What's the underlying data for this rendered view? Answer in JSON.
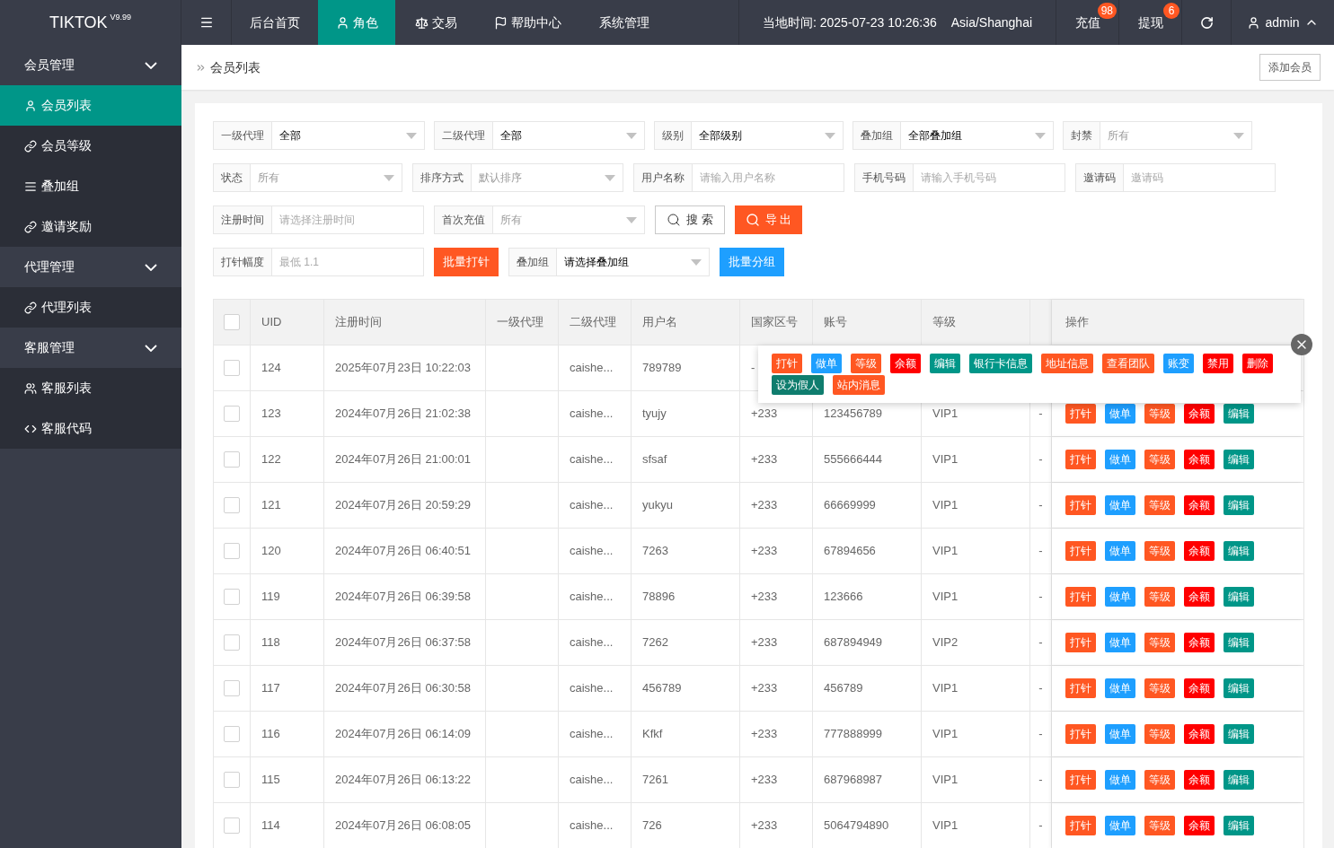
{
  "brand": {
    "name": "TIKTOK",
    "version": "V9.99"
  },
  "top_menu": [
    {
      "label": "后台首页",
      "selected": false
    },
    {
      "label": "角色",
      "selected": true
    },
    {
      "label": "交易",
      "selected": false
    },
    {
      "label": "帮助中心",
      "selected": false
    },
    {
      "label": "系统管理",
      "selected": false
    }
  ],
  "header": {
    "time": "当地时间: 2025-07-23 10:26:36",
    "timezone": "Asia/Shanghai",
    "recharge": {
      "label": "充值",
      "badge": "98"
    },
    "withdraw": {
      "label": "提现",
      "badge": "6"
    },
    "user": "admin"
  },
  "sidebar": [
    {
      "label": "会员管理",
      "expanded": true,
      "children": [
        {
          "label": "会员列表",
          "selected": true
        },
        {
          "label": "会员等级",
          "selected": false
        },
        {
          "label": "叠加组",
          "selected": false
        },
        {
          "label": "邀请奖励",
          "selected": false
        }
      ]
    },
    {
      "label": "代理管理",
      "expanded": true,
      "children": [
        {
          "label": "代理列表",
          "selected": false
        }
      ]
    },
    {
      "label": "客服管理",
      "expanded": true,
      "children": [
        {
          "label": "客服列表",
          "selected": false
        },
        {
          "label": "客服代码",
          "selected": false
        }
      ]
    }
  ],
  "breadcrumb": "会员列表",
  "add_button": "添加会员",
  "filters": [
    [
      {
        "kind": "select",
        "label": "一级代理",
        "value": "全部"
      },
      {
        "kind": "select",
        "label": "二级代理",
        "value": "全部"
      },
      {
        "kind": "select",
        "label": "级别",
        "value": "全部级别"
      },
      {
        "kind": "select",
        "label": "叠加组",
        "value": "全部叠加组"
      },
      {
        "kind": "select",
        "label": "封禁",
        "placeholder": "所有"
      }
    ],
    [
      {
        "kind": "select",
        "label": "状态",
        "placeholder": "所有"
      },
      {
        "kind": "select",
        "label": "排序方式",
        "placeholder": "默认排序"
      },
      {
        "kind": "input",
        "label": "用户名称",
        "placeholder": "请输入用户名称"
      },
      {
        "kind": "input",
        "label": "手机号码",
        "placeholder": "请输入手机号码"
      },
      {
        "kind": "input",
        "label": "邀请码",
        "placeholder": "邀请码"
      }
    ],
    [
      {
        "kind": "input",
        "label": "注册时间",
        "placeholder": "请选择注册时间"
      },
      {
        "kind": "select",
        "label": "首次充值",
        "placeholder": "所有"
      },
      {
        "kind": "search",
        "label": "搜 索"
      },
      {
        "kind": "export",
        "label": "导 出"
      }
    ],
    [
      {
        "kind": "input",
        "label": "打针幅度",
        "placeholder": "最低 1.1"
      },
      {
        "kind": "button",
        "label": "批量打针",
        "color": "#ff5722"
      },
      {
        "kind": "select",
        "label": "叠加组",
        "value": "请选择叠加组"
      },
      {
        "kind": "button",
        "label": "批量分组",
        "color": "#1e9fff"
      }
    ]
  ],
  "table": {
    "all_checked": false,
    "columns": [
      "UID",
      "注册时间",
      "一级代理",
      "二级代理",
      "用户名",
      "国家区号",
      "账号",
      "等级",
      "操作"
    ],
    "rows": [
      {
        "checked": false,
        "uid": "124",
        "time": "2025年07月23日 10:22:03",
        "agent2": "caishe...",
        "username": "789789",
        "country": "-"
      },
      {
        "checked": false,
        "uid": "123",
        "time": "2024年07月26日 21:02:38",
        "agent2": "caishe...",
        "username": "tyujy",
        "country": "+233",
        "account": "123456789",
        "level": "VIP1",
        "column_9": "-",
        "actions": [
          {
            "label": "打针",
            "color": "#ff5722"
          },
          {
            "label": "做单",
            "color": "#1e9fff"
          },
          {
            "label": "等级",
            "color": "#ff5722"
          },
          {
            "label": "余额",
            "color": "#ff0000"
          },
          {
            "label": "编辑",
            "color": "#009688"
          }
        ]
      },
      {
        "checked": false,
        "uid": "122",
        "time": "2024年07月26日 21:00:01",
        "agent2": "caishe...",
        "username": "sfsaf",
        "country": "+233",
        "account": "555666444",
        "level": "VIP1",
        "column_9": "-",
        "actions": [
          {
            "label": "打针",
            "color": "#ff5722"
          },
          {
            "label": "做单",
            "color": "#1e9fff"
          },
          {
            "label": "等级",
            "color": "#ff5722"
          },
          {
            "label": "余额",
            "color": "#ff0000"
          },
          {
            "label": "编辑",
            "color": "#009688"
          }
        ]
      },
      {
        "checked": false,
        "uid": "121",
        "time": "2024年07月26日 20:59:29",
        "agent2": "caishe...",
        "username": "yukyu",
        "country": "+233",
        "account": "66669999",
        "level": "VIP1",
        "column_9": "-",
        "actions": [
          {
            "label": "打针",
            "color": "#ff5722"
          },
          {
            "label": "做单",
            "color": "#1e9fff"
          },
          {
            "label": "等级",
            "color": "#ff5722"
          },
          {
            "label": "余额",
            "color": "#ff0000"
          },
          {
            "label": "编辑",
            "color": "#009688"
          }
        ]
      },
      {
        "checked": false,
        "uid": "120",
        "time": "2024年07月26日 06:40:51",
        "agent2": "caishe...",
        "username": "7263",
        "country": "+233",
        "account": "67894656",
        "level": "VIP1",
        "column_9": "-",
        "actions": [
          {
            "label": "打针",
            "color": "#ff5722"
          },
          {
            "label": "做单",
            "color": "#1e9fff"
          },
          {
            "label": "等级",
            "color": "#ff5722"
          },
          {
            "label": "余额",
            "color": "#ff0000"
          },
          {
            "label": "编辑",
            "color": "#009688"
          }
        ]
      },
      {
        "checked": false,
        "uid": "119",
        "time": "2024年07月26日 06:39:58",
        "agent2": "caishe...",
        "username": "78896",
        "country": "+233",
        "account": "123666",
        "level": "VIP1",
        "column_9": "-",
        "actions": [
          {
            "label": "打针",
            "color": "#ff5722"
          },
          {
            "label": "做单",
            "color": "#1e9fff"
          },
          {
            "label": "等级",
            "color": "#ff5722"
          },
          {
            "label": "余额",
            "color": "#ff0000"
          },
          {
            "label": "编辑",
            "color": "#009688"
          }
        ]
      },
      {
        "checked": false,
        "uid": "118",
        "time": "2024年07月26日 06:37:58",
        "agent2": "caishe...",
        "username": "7262",
        "country": "+233",
        "account": "687894949",
        "level": "VIP2",
        "column_9": "-",
        "actions": [
          {
            "label": "打针",
            "color": "#ff5722"
          },
          {
            "label": "做单",
            "color": "#1e9fff"
          },
          {
            "label": "等级",
            "color": "#ff5722"
          },
          {
            "label": "余额",
            "color": "#ff0000"
          },
          {
            "label": "编辑",
            "color": "#009688"
          }
        ]
      },
      {
        "checked": false,
        "uid": "117",
        "time": "2024年07月26日 06:30:58",
        "agent2": "caishe...",
        "username": "456789",
        "country": "+233",
        "account": "456789",
        "level": "VIP1",
        "column_9": "-",
        "actions": [
          {
            "label": "打针",
            "color": "#ff5722"
          },
          {
            "label": "做单",
            "color": "#1e9fff"
          },
          {
            "label": "等级",
            "color": "#ff5722"
          },
          {
            "label": "余额",
            "color": "#ff0000"
          },
          {
            "label": "编辑",
            "color": "#009688"
          }
        ]
      },
      {
        "checked": false,
        "uid": "116",
        "time": "2024年07月26日 06:14:09",
        "agent2": "caishe...",
        "username": "Kfkf",
        "country": "+233",
        "account": "777888999",
        "level": "VIP1",
        "column_9": "-",
        "actions": [
          {
            "label": "打针",
            "color": "#ff5722"
          },
          {
            "label": "做单",
            "color": "#1e9fff"
          },
          {
            "label": "等级",
            "color": "#ff5722"
          },
          {
            "label": "余额",
            "color": "#ff0000"
          },
          {
            "label": "编辑",
            "color": "#009688"
          }
        ]
      },
      {
        "checked": false,
        "uid": "115",
        "time": "2024年07月26日 06:13:22",
        "agent2": "caishe...",
        "username": "7261",
        "country": "+233",
        "account": "687968987",
        "level": "VIP1",
        "column_9": "-",
        "actions": [
          {
            "label": "打针",
            "color": "#ff5722"
          },
          {
            "label": "做单",
            "color": "#1e9fff"
          },
          {
            "label": "等级",
            "color": "#ff5722"
          },
          {
            "label": "余额",
            "color": "#ff0000"
          },
          {
            "label": "编辑",
            "color": "#009688"
          }
        ]
      },
      {
        "checked": false,
        "uid": "114",
        "time": "2024年07月26日 06:08:05",
        "agent2": "caishe...",
        "username": "726",
        "country": "+233",
        "account": "5064794890",
        "level": "VIP1",
        "column_9": "-",
        "actions": [
          {
            "label": "打针",
            "color": "#ff5722"
          },
          {
            "label": "做单",
            "color": "#1e9fff"
          },
          {
            "label": "等级",
            "color": "#ff5722"
          },
          {
            "label": "余额",
            "color": "#ff0000"
          },
          {
            "label": "编辑",
            "color": "#009688"
          }
        ]
      }
    ]
  },
  "action_menu": {
    "open": true,
    "buttons": [
      {
        "label": "打针",
        "color": "#ff5722"
      },
      {
        "label": "做单",
        "color": "#1e9fff"
      },
      {
        "label": "等级",
        "color": "#ff5722"
      },
      {
        "label": "余额",
        "color": "#ff0000"
      },
      {
        "label": "编辑",
        "color": "#009688"
      },
      {
        "label": "银行卡信息",
        "color": "#009688"
      },
      {
        "label": "地址信息",
        "color": "#ff5722"
      },
      {
        "label": "查看团队",
        "color": "#ff5722"
      },
      {
        "label": "账变",
        "color": "#1e9fff"
      },
      {
        "label": "禁用",
        "color": "#ff0000"
      },
      {
        "label": "删除",
        "color": "#ff0000"
      },
      {
        "label": "设为假人",
        "color": "#0f7d6e"
      },
      {
        "label": "站内消息",
        "color": "#ff5722"
      }
    ]
  }
}
